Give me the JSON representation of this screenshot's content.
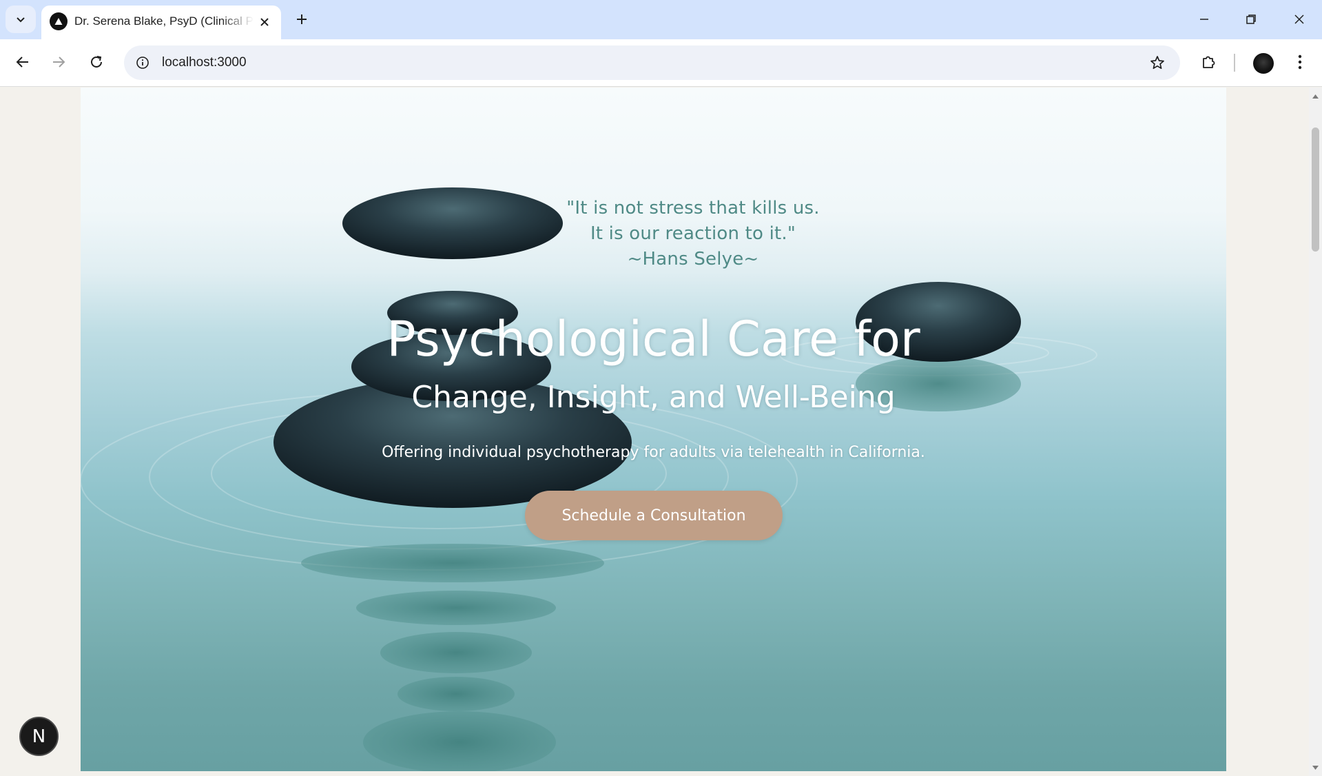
{
  "browser": {
    "tab": {
      "title": "Dr. Serena Blake, PsyD (Clinical Psychologist)"
    },
    "address_bar": {
      "url": "localhost:3000"
    },
    "icons": {
      "tab_search": "chevron-down-icon",
      "favicon": "triangle-logo-icon",
      "close_tab": "close-icon",
      "new_tab": "plus-icon",
      "back": "arrow-left-icon",
      "forward": "arrow-right-icon",
      "reload": "reload-icon",
      "site_info": "info-icon",
      "bookmark": "star-icon",
      "extensions": "puzzle-icon",
      "menu": "kebab-menu-icon",
      "minimize": "minimize-icon",
      "maximize": "restore-icon",
      "close_window": "close-icon"
    }
  },
  "hero": {
    "quote_line1": "\"It is not stress that kills us.",
    "quote_line2": "It is our reaction to it.\"",
    "quote_author": "~Hans Selye~",
    "headline": "Psychological Care for",
    "subheadline": "Change, Insight, and Well-Being",
    "tagline": "Offering individual psychotherapy for adults via telehealth in California.",
    "cta_label": "Schedule a Consultation"
  },
  "dev_badge": {
    "label": "N"
  },
  "colors": {
    "tab_strip": "#d3e3fd",
    "quote_text": "#4f8a86",
    "cta_background": "#c09f87",
    "page_background": "#f3f1ec"
  }
}
